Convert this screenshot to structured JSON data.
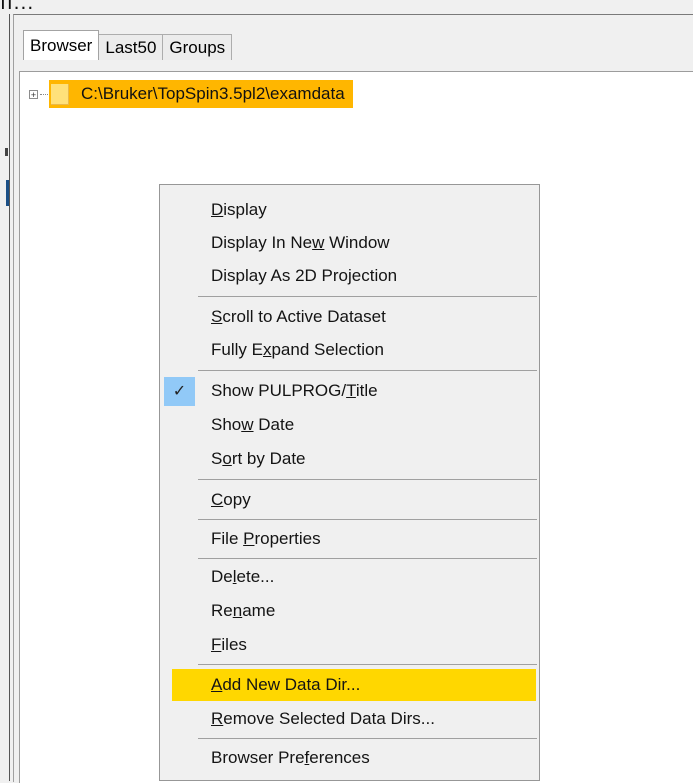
{
  "tabs": [
    {
      "label": "Browser",
      "active": true
    },
    {
      "label": "Last50",
      "active": false
    },
    {
      "label": "Groups",
      "active": false
    }
  ],
  "tree": {
    "root_path": "C:\\Bruker\\TopSpin3.5pl2\\examdata",
    "expander": "+",
    "selected": true,
    "selection_color": "#ffb600"
  },
  "top_fragment": "ıı...",
  "context_menu": {
    "items": [
      {
        "pre": "",
        "u": "D",
        "post": "isplay"
      },
      {
        "pre": "Display In Ne",
        "u": "w",
        "post": " Window"
      },
      {
        "pre": "Display As 2D Projection",
        "u": "",
        "post": ""
      },
      {
        "pre": "",
        "u": "S",
        "post": "croll to Active Dataset"
      },
      {
        "pre": "Fully E",
        "u": "x",
        "post": "pand Selection"
      },
      {
        "pre": "Show PULPROG/",
        "u": "T",
        "post": "itle",
        "checked": true,
        "check_glyph": "✓"
      },
      {
        "pre": "Sho",
        "u": "w",
        "post": " Date"
      },
      {
        "pre": "S",
        "u": "o",
        "post": "rt by Date"
      },
      {
        "pre": "",
        "u": "C",
        "post": "opy"
      },
      {
        "pre": "File ",
        "u": "P",
        "post": "roperties"
      },
      {
        "pre": "De",
        "u": "l",
        "post": "ete..."
      },
      {
        "pre": "Re",
        "u": "n",
        "post": "ame"
      },
      {
        "pre": "",
        "u": "F",
        "post": "iles"
      },
      {
        "pre": "",
        "u": "A",
        "post": "dd New Data Dir...",
        "highlighted": true
      },
      {
        "pre": "",
        "u": "R",
        "post": "emove Selected Data Dirs..."
      },
      {
        "pre": "Browser Pre",
        "u": "f",
        "post": "erences"
      }
    ],
    "highlight_color": "#ffd700",
    "check_bg_color": "#91c9f7"
  }
}
